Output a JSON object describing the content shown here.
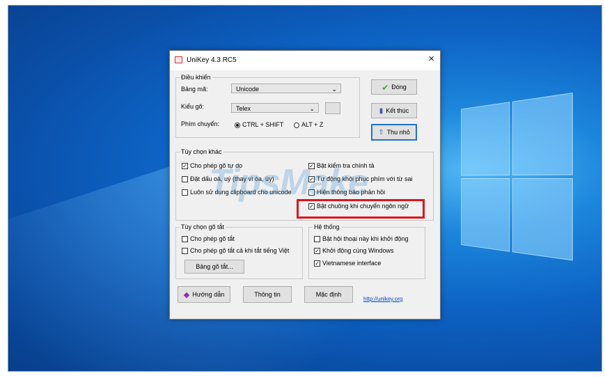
{
  "window": {
    "title": "UniKey 4.3 RC5",
    "close": "×"
  },
  "dieu_khien": {
    "legend": "Điều khiển",
    "bang_ma_label": "Bảng mã:",
    "bang_ma_value": "Unicode",
    "kieu_go_label": "Kiểu gõ:",
    "kieu_go_value": "Telex",
    "phim_chuyen_label": "Phím chuyển:",
    "radio_ctrl_shift": "CTRL + SHIFT",
    "radio_alt_z": "ALT + Z",
    "selected": "ctrl_shift"
  },
  "side_buttons": {
    "dong": "Đóng",
    "ket_thuc": "Kết thúc",
    "thu_nho": "Thu nhỏ"
  },
  "tuy_chon_khac": {
    "legend": "Tùy chọn khác",
    "left": [
      {
        "label": "Cho phép gõ tự do",
        "checked": true
      },
      {
        "label": "Đặt dấu oà, uý (thay vì òa, úy)",
        "checked": false
      },
      {
        "label": "Luôn sử dụng clipboard cho unicode",
        "checked": false
      }
    ],
    "right": [
      {
        "label": "Bật kiểm tra chính tả",
        "checked": true
      },
      {
        "label": "Tự động khôi phục phím với từ sai",
        "checked": true
      },
      {
        "label": "Hiện thông báo phản hồi",
        "checked": false
      },
      {
        "label": "Bật chuông khi chuyển ngôn ngữ",
        "checked": true
      }
    ]
  },
  "tuy_chon_go_tat": {
    "legend": "Tùy chọn gõ tắt",
    "items": [
      {
        "label": "Cho phép gõ tắt",
        "checked": false
      },
      {
        "label": "Cho phép gõ tắt cả khi tắt tiếng Việt",
        "checked": false
      }
    ],
    "button": "Bảng gõ tắt..."
  },
  "he_thong": {
    "legend": "Hệ thống",
    "items": [
      {
        "label": "Bật hội thoại này khi khởi động",
        "checked": false
      },
      {
        "label": "Khởi động cùng Windows",
        "checked": true
      },
      {
        "label": "Vietnamese interface",
        "checked": true
      }
    ]
  },
  "bottom": {
    "huong_dan": "Hướng dẫn",
    "thong_tin": "Thông tin",
    "mac_dinh": "Mặc định",
    "link": "http://unikey.org"
  },
  "watermark": "TipsMake",
  "colors": {
    "highlight": "#e0141c",
    "desktop": "#0d63c4",
    "link": "#0044cc"
  }
}
